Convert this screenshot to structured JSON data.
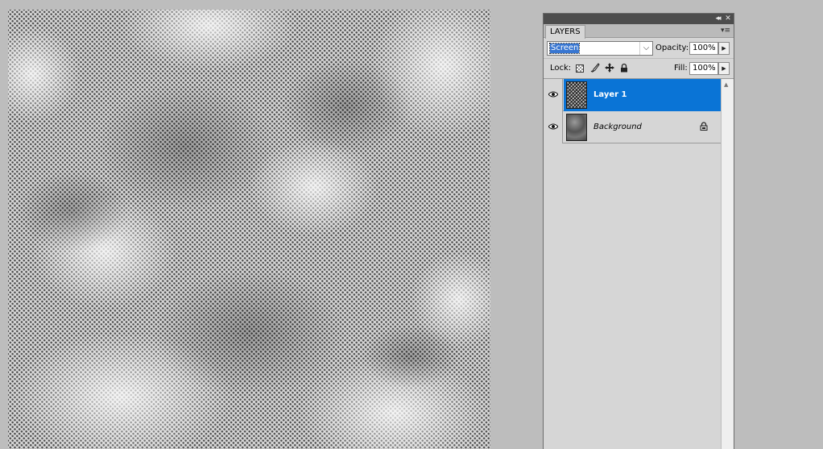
{
  "colors": {
    "workspace": "#bdbdbd",
    "selected_layer": "#0a74d6",
    "panel": "#d6d6d6"
  },
  "panel": {
    "collapse_icon": "double-chevron-left-icon",
    "close_icon": "close-icon",
    "tab_label": "LAYERS",
    "menu_icon": "panel-menu-icon",
    "blend_mode": "Screen",
    "opacity_label": "Opacity:",
    "opacity_value": "100%",
    "lock_label": "Lock:",
    "fill_label": "Fill:",
    "fill_value": "100%"
  },
  "layers": [
    {
      "name": "Layer 1",
      "visible": true,
      "selected": true,
      "locked": false
    },
    {
      "name": "Background",
      "visible": true,
      "selected": false,
      "locked": true
    }
  ]
}
